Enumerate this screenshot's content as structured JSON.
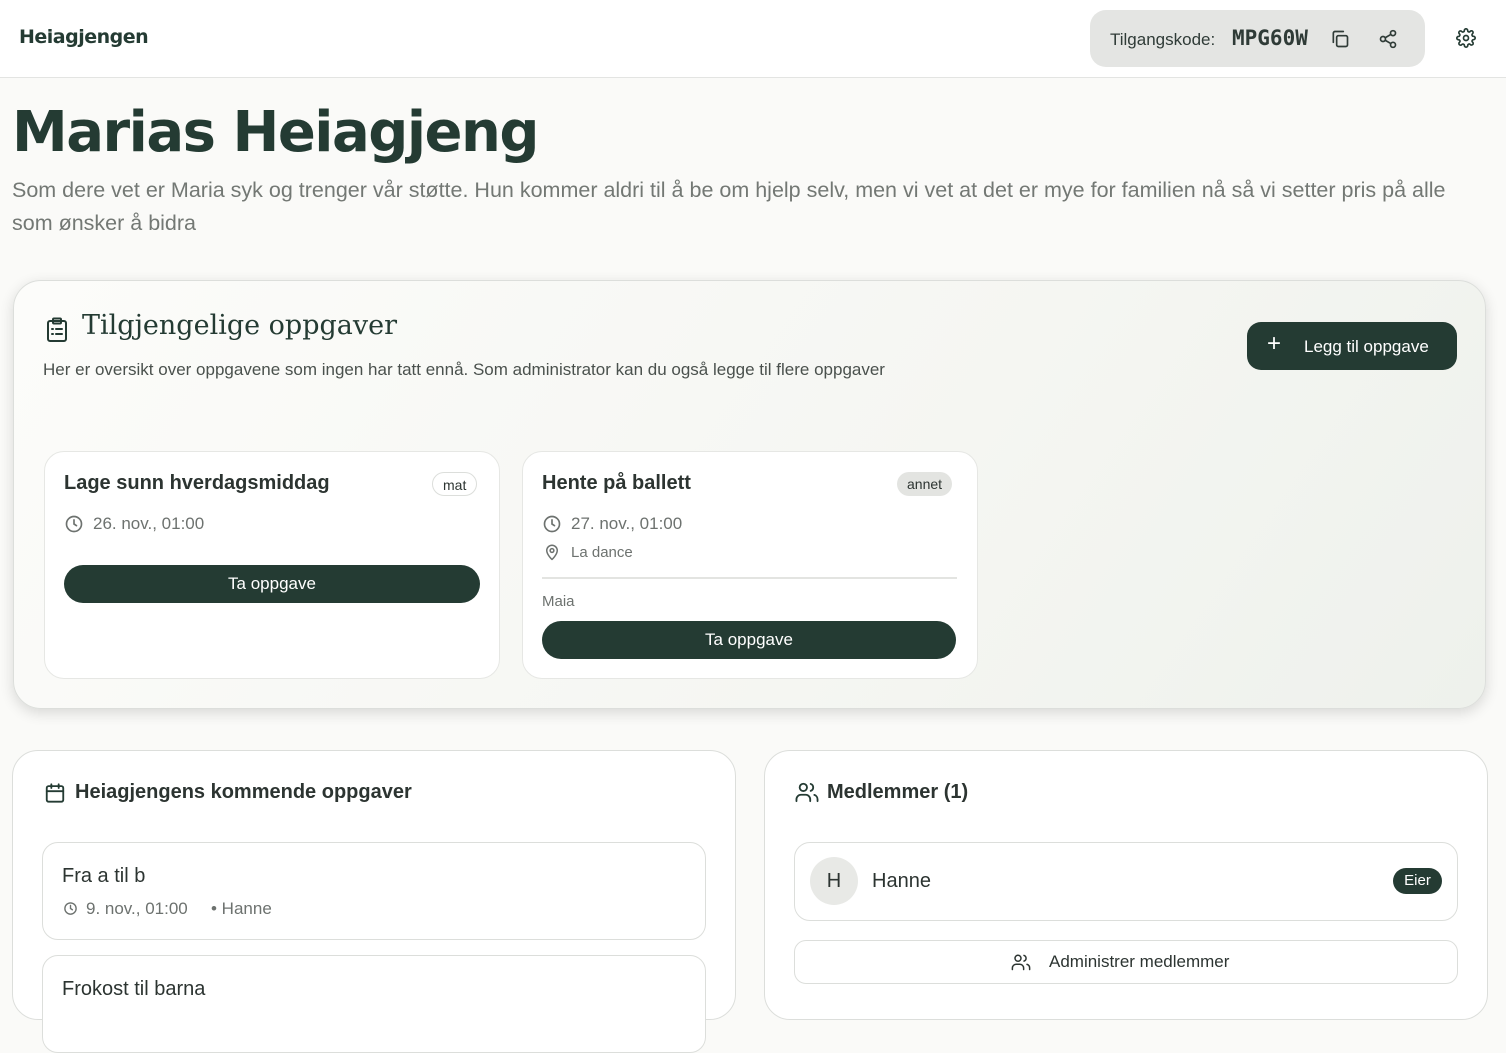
{
  "header": {
    "logo": "Heiagjengen",
    "access_label": "Tilgangskode:",
    "access_code": "MPG60W",
    "copy_icon": "copy-icon",
    "share_icon": "share-icon",
    "settings_icon": "gear-icon"
  },
  "hero": {
    "title": "Marias Heiagjeng",
    "description": "Som dere vet er Maria syk og trenger vår støtte. Hun kommer aldri til å be om hjelp selv, men vi vet at det er mye for familien nå så vi setter pris på alle som ønsker å bidra"
  },
  "available": {
    "title": "Tilgjengelige oppgaver",
    "subtitle": "Her er oversikt over oppgavene som ingen har tatt ennå. Som administrator kan du også legge til flere oppgaver",
    "add_button": "Legg til oppgave",
    "tasks": [
      {
        "title": "Lage sunn hverdagsmiddag",
        "tag": "mat",
        "datetime": "26. nov., 01:00",
        "button": "Ta oppgave"
      },
      {
        "title": "Hente på ballett",
        "tag": "annet",
        "datetime": "27. nov., 01:00",
        "location": "La dance",
        "assignee": "Maia",
        "button": "Ta oppgave"
      }
    ]
  },
  "upcoming": {
    "title": "Heiagjengens kommende oppgaver",
    "items": [
      {
        "title": "Fra a til b",
        "datetime": "9. nov., 01:00",
        "person": "• Hanne"
      },
      {
        "title": "Frokost til barna"
      }
    ]
  },
  "members": {
    "title": "Medlemmer (1)",
    "list": [
      {
        "initial": "H",
        "name": "Hanne",
        "role": "Eier"
      }
    ],
    "manage_button": "Administrer medlemmer"
  },
  "colors": {
    "primary": "#243b33",
    "muted": "#737874",
    "border": "#dcdedb"
  }
}
